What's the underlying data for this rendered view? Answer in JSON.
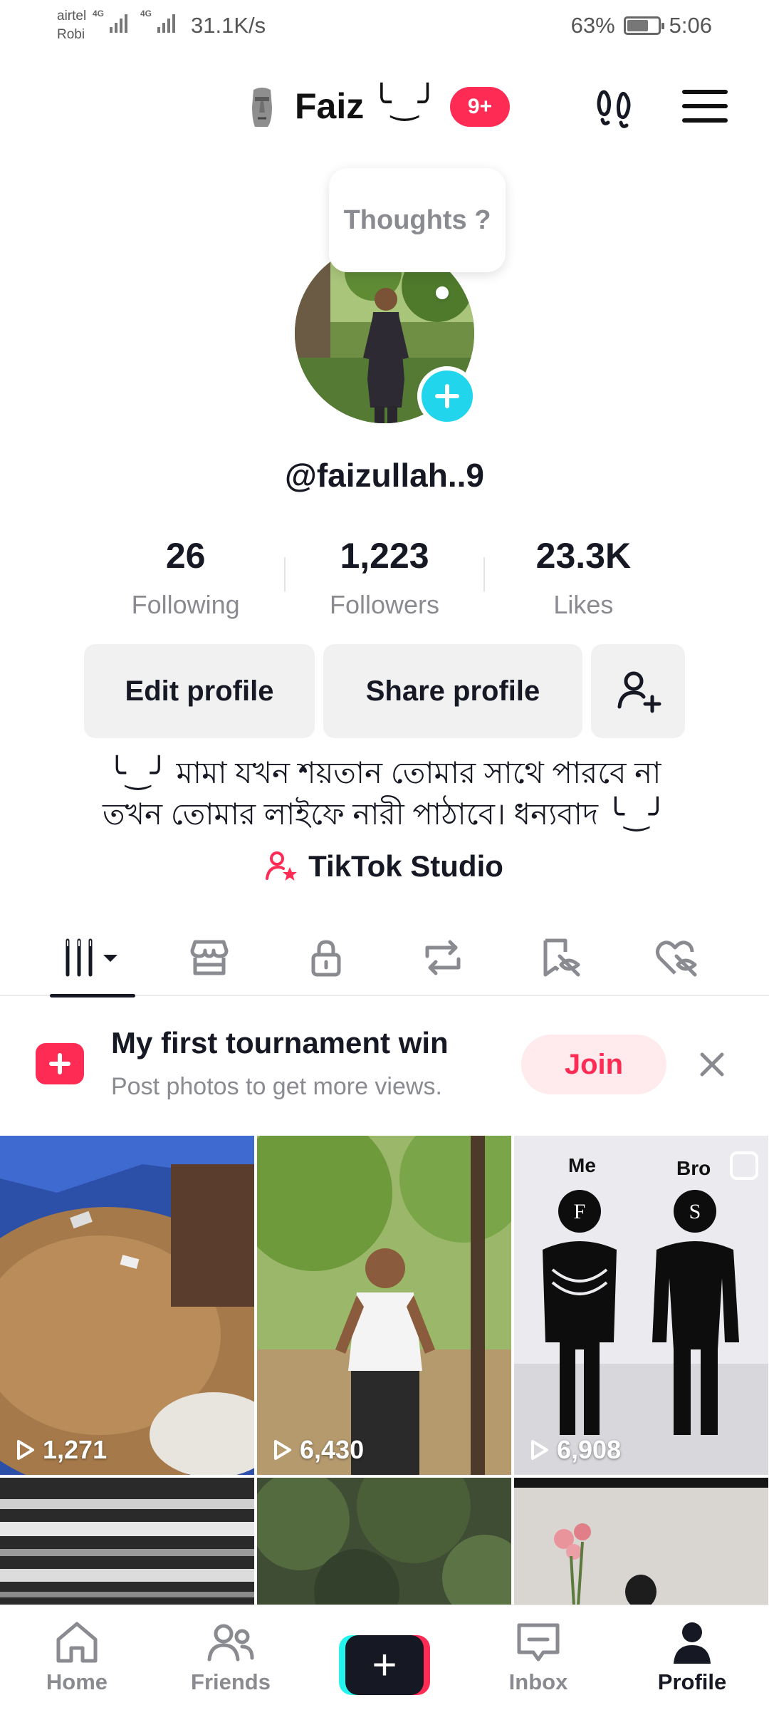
{
  "status_bar": {
    "carrier_1": "airtel",
    "carrier_2": "Robi",
    "net_type_1": "4G",
    "net_type_2": "4G",
    "net_speed": "31.1K/s",
    "battery_percent": "63%",
    "time": "5:06"
  },
  "header": {
    "display_name": "Faiz",
    "name_decoration": "╰‿╯",
    "notification_badge": "9+"
  },
  "profile": {
    "thought_bubble": "Thoughts ?",
    "handle": "@faizullah..9",
    "stats": {
      "following_count": "26",
      "following_label": "Following",
      "followers_count": "1,223",
      "followers_label": "Followers",
      "likes_count": "23.3K",
      "likes_label": "Likes"
    },
    "buttons": {
      "edit": "Edit profile",
      "share": "Share profile"
    },
    "bio_line_1": "╰‿╯ মামা যখন শয়তান তোমার সাথে পারবে না",
    "bio_line_2": "তখন তোমার লাইফে নারী পাঠাবে। ধন্যবাদ ╰‿╯",
    "studio_label": "TikTok Studio"
  },
  "tabs": [
    "videos-icon",
    "store-icon",
    "lock-icon",
    "repost-icon",
    "favorites-icon",
    "liked-icon"
  ],
  "promo": {
    "title": "My first tournament win",
    "subtitle": "Post photos to get more views.",
    "join_label": "Join"
  },
  "videos": [
    {
      "views": "1,271"
    },
    {
      "views": "6,430"
    },
    {
      "views": "6,908",
      "meme_left": "Me",
      "meme_right": "Bro",
      "letter_left": "F",
      "letter_right": "S"
    }
  ],
  "bottom_nav": {
    "home": "Home",
    "friends": "Friends",
    "inbox": "Inbox",
    "profile": "Profile"
  },
  "colors": {
    "accent": "#fe2c55",
    "cyan": "#20d5ec",
    "text": "#161823",
    "muted": "#8a8b91"
  }
}
